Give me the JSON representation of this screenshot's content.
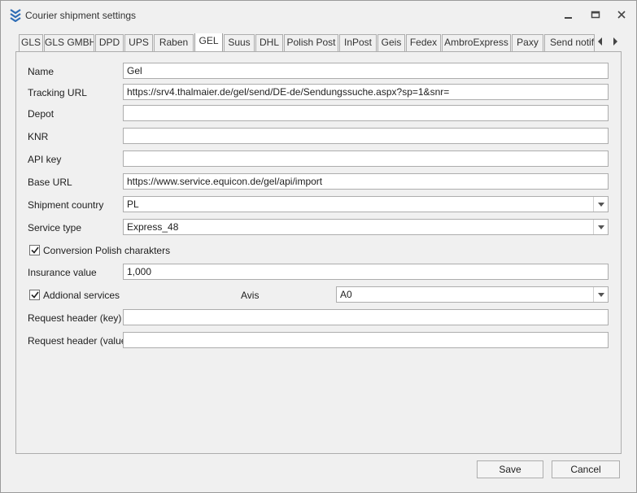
{
  "window": {
    "title": "Courier shipment settings",
    "icon": "layers-chevron-icon",
    "controls": [
      "minimize-icon",
      "restore-icon",
      "close-icon"
    ]
  },
  "tabs": [
    {
      "label": "GLS",
      "active": false
    },
    {
      "label": "GLS GMBH",
      "active": false
    },
    {
      "label": "DPD",
      "active": false
    },
    {
      "label": "UPS",
      "active": false
    },
    {
      "label": "Raben",
      "active": false
    },
    {
      "label": "GEL",
      "active": true
    },
    {
      "label": "Suus",
      "active": false
    },
    {
      "label": "DHL",
      "active": false
    },
    {
      "label": "Polish Post",
      "active": false
    },
    {
      "label": "InPost",
      "active": false
    },
    {
      "label": "Geis",
      "active": false
    },
    {
      "label": "Fedex",
      "active": false
    },
    {
      "label": "AmbroExpress",
      "active": false
    },
    {
      "label": "Paxy",
      "active": false
    },
    {
      "label": "Send notifi",
      "active": false
    }
  ],
  "form": {
    "name": {
      "label": "Name",
      "value": "Gel"
    },
    "tracking_url": {
      "label": "Tracking URL",
      "value": "https://srv4.thalmaier.de/gel/send/DE-de/Sendungssuche.aspx?sp=1&snr="
    },
    "depot": {
      "label": "Depot",
      "value": ""
    },
    "knr": {
      "label": "KNR",
      "value": ""
    },
    "api_key": {
      "label": "API key",
      "value": ""
    },
    "base_url": {
      "label": "Base URL",
      "value": "https://www.service.equicon.de/gel/api/import"
    },
    "shipment_country": {
      "label": "Shipment country",
      "value": "PL"
    },
    "service_type": {
      "label": "Service type",
      "value": "Express_48"
    },
    "conversion_polish": {
      "label": "Conversion Polish charakters",
      "checked": true
    },
    "insurance_value": {
      "label": "Insurance value",
      "value": "1,000"
    },
    "additional_services": {
      "label": "Addional services",
      "checked": true
    },
    "avis": {
      "label": "Avis",
      "value": "A0"
    },
    "request_header_key": {
      "label": "Request header (key)",
      "value": ""
    },
    "request_header_value": {
      "label": "Request header (value)",
      "value": ""
    }
  },
  "buttons": {
    "save": "Save",
    "cancel": "Cancel"
  },
  "colors": {
    "window_bg": "#f0f0f0",
    "field_border": "#adadad",
    "icon_blue": "#2f6db5"
  }
}
